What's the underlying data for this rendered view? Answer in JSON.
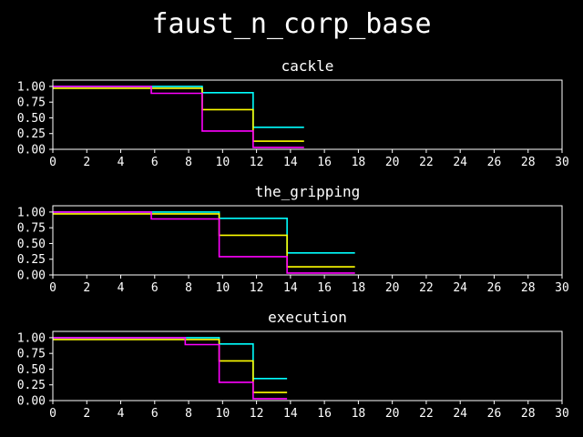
{
  "figure": {
    "title": "faust_n_corp_base",
    "background": "#000000",
    "foreground": "#ffffff"
  },
  "chart_data": [
    {
      "type": "line",
      "step": true,
      "title": "cackle",
      "xlabel": "",
      "ylabel": "",
      "xlim": [
        0,
        30
      ],
      "ylim": [
        0,
        1.1
      ],
      "xticks": [
        0,
        2,
        4,
        6,
        8,
        10,
        12,
        14,
        16,
        18,
        20,
        22,
        24,
        26,
        28,
        30
      ],
      "yticks": [
        0.0,
        0.25,
        0.5,
        0.75,
        1.0
      ],
      "xtick_labels": [
        "0",
        "2",
        "4",
        "6",
        "8",
        "10",
        "12",
        "14",
        "16",
        "18",
        "20",
        "22",
        "24",
        "26",
        "28",
        "30"
      ],
      "ytick_labels": [
        "0.00",
        "0.25",
        "0.50",
        "0.75",
        "1.00"
      ],
      "grid": false,
      "legend": null,
      "series": [
        {
          "color": "#00ffff",
          "x": [
            0,
            8.8,
            11.8,
            14.8
          ],
          "y": [
            1.0,
            0.9,
            0.35,
            0.35
          ]
        },
        {
          "color": "#ffff00",
          "x": [
            0,
            8.8,
            11.8,
            14.8
          ],
          "y": [
            0.97,
            0.63,
            0.13,
            0.13
          ]
        },
        {
          "color": "#ff00ff",
          "x": [
            0,
            5.8,
            8.8,
            11.8,
            14.8
          ],
          "y": [
            1.0,
            0.89,
            0.29,
            0.03,
            0.03
          ]
        }
      ]
    },
    {
      "type": "line",
      "step": true,
      "title": "the_gripping",
      "xlabel": "",
      "ylabel": "",
      "xlim": [
        0,
        30
      ],
      "ylim": [
        0,
        1.1
      ],
      "xticks": [
        0,
        2,
        4,
        6,
        8,
        10,
        12,
        14,
        16,
        18,
        20,
        22,
        24,
        26,
        28,
        30
      ],
      "yticks": [
        0.0,
        0.25,
        0.5,
        0.75,
        1.0
      ],
      "xtick_labels": [
        "0",
        "2",
        "4",
        "6",
        "8",
        "10",
        "12",
        "14",
        "16",
        "18",
        "20",
        "22",
        "24",
        "26",
        "28",
        "30"
      ],
      "ytick_labels": [
        "0.00",
        "0.25",
        "0.50",
        "0.75",
        "1.00"
      ],
      "grid": false,
      "legend": null,
      "series": [
        {
          "color": "#00ffff",
          "x": [
            0,
            9.8,
            13.8,
            17.8
          ],
          "y": [
            1.0,
            0.9,
            0.35,
            0.35
          ]
        },
        {
          "color": "#ffff00",
          "x": [
            0,
            9.8,
            13.8,
            17.8
          ],
          "y": [
            0.97,
            0.63,
            0.13,
            0.13
          ]
        },
        {
          "color": "#ff00ff",
          "x": [
            0,
            5.8,
            9.8,
            13.8,
            17.8
          ],
          "y": [
            1.0,
            0.89,
            0.29,
            0.03,
            0.03
          ]
        }
      ]
    },
    {
      "type": "line",
      "step": true,
      "title": "execution",
      "xlabel": "",
      "ylabel": "",
      "xlim": [
        0,
        30
      ],
      "ylim": [
        0,
        1.1
      ],
      "xticks": [
        0,
        2,
        4,
        6,
        8,
        10,
        12,
        14,
        16,
        18,
        20,
        22,
        24,
        26,
        28,
        30
      ],
      "yticks": [
        0.0,
        0.25,
        0.5,
        0.75,
        1.0
      ],
      "xtick_labels": [
        "0",
        "2",
        "4",
        "6",
        "8",
        "10",
        "12",
        "14",
        "16",
        "18",
        "20",
        "22",
        "24",
        "26",
        "28",
        "30"
      ],
      "ytick_labels": [
        "0.00",
        "0.25",
        "0.50",
        "0.75",
        "1.00"
      ],
      "grid": false,
      "legend": null,
      "series": [
        {
          "color": "#00ffff",
          "x": [
            0,
            9.8,
            11.8,
            13.8
          ],
          "y": [
            1.0,
            0.9,
            0.35,
            0.35
          ]
        },
        {
          "color": "#ffff00",
          "x": [
            0,
            9.8,
            11.8,
            13.8
          ],
          "y": [
            0.97,
            0.63,
            0.13,
            0.13
          ]
        },
        {
          "color": "#ff00ff",
          "x": [
            0,
            7.8,
            9.8,
            11.8,
            13.8
          ],
          "y": [
            1.0,
            0.89,
            0.29,
            0.03,
            0.03
          ]
        }
      ]
    }
  ]
}
